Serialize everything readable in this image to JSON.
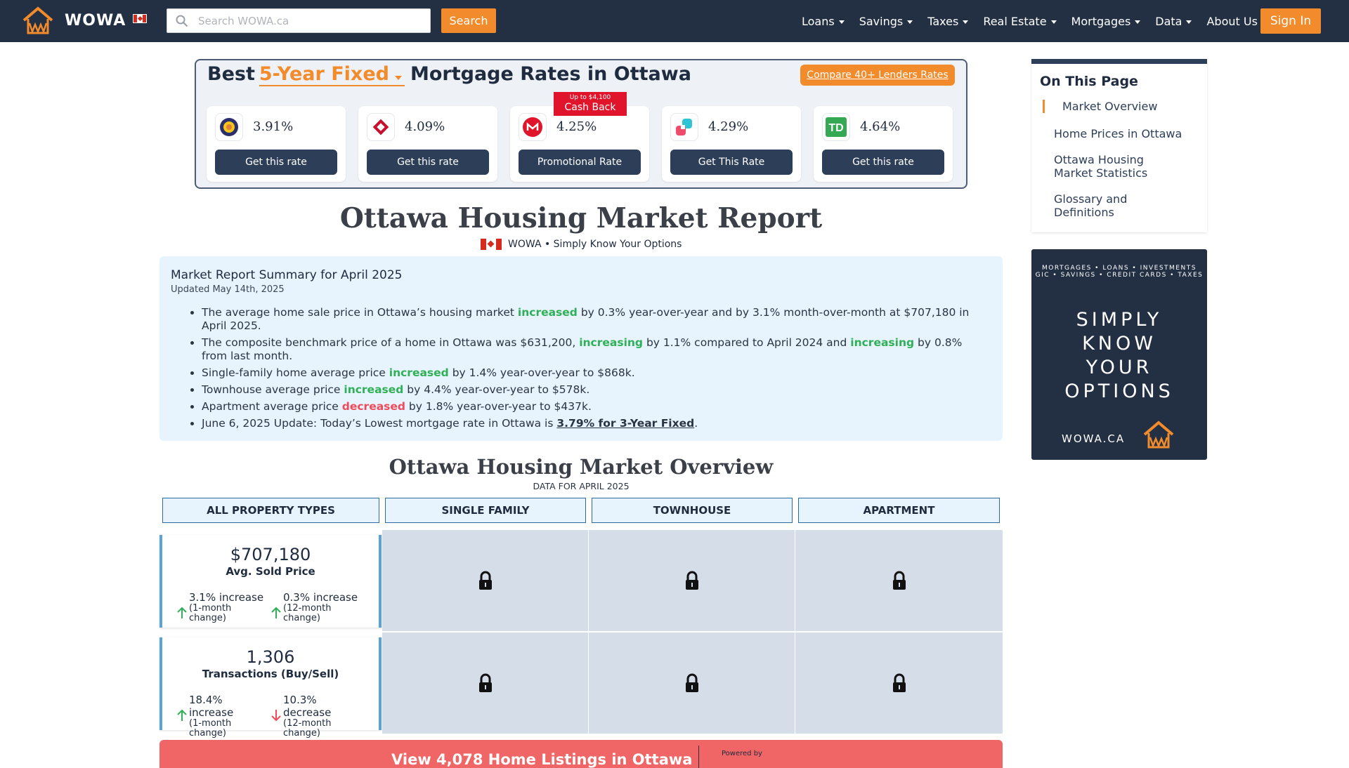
{
  "header": {
    "logo_text": "WOWA",
    "search_placeholder": "Search WOWA.ca",
    "search_button": "Search",
    "nav": [
      "Loans",
      "Savings",
      "Taxes",
      "Real Estate",
      "Mortgages",
      "Data",
      "About Us"
    ],
    "signin": "Sign In"
  },
  "rates": {
    "title_prefix": "Best",
    "product": "5-Year Fixed",
    "title_suffix": "Mortgage Rates in Ottawa",
    "compare_button": "Compare 40+ Lenders Rates",
    "cards": [
      {
        "rate": "3.91%",
        "button": "Get this rate",
        "logo": "circle-logo-icon"
      },
      {
        "rate": "4.09%",
        "button": "Get this rate",
        "logo": "diamond-logo-icon"
      },
      {
        "rate": "4.25%",
        "button": "Promotional Rate",
        "logo": "bmo-logo-icon",
        "badge_small": "Up to $4,100",
        "badge_big": "Cash Back"
      },
      {
        "rate": "4.29%",
        "button": "Get This Rate",
        "logo": "squares-logo-icon"
      },
      {
        "rate": "4.64%",
        "button": "Get this rate",
        "logo": "td-logo-icon"
      }
    ]
  },
  "report": {
    "title": "Ottawa Housing Market Report",
    "byline": "WOWA • Simply Know Your Options"
  },
  "summary": {
    "heading": "Market Report Summary for April 2025",
    "updated": "Updated May 14th, 2025",
    "b1": {
      "pre": "The average home sale price in Ottawa’s housing market ",
      "kw": "increased",
      "post": " by 0.3% year-over-year and by 3.1% month-over-month at $707,180 in April 2025."
    },
    "b2": {
      "pre": "The composite benchmark price of a home in Ottawa was $631,200, ",
      "kw": "increasing",
      "mid": " by 1.1% compared to April 2024 and ",
      "kw2": "increasing",
      "post": " by 0.8% from last month."
    },
    "b3": {
      "pre": "Single-family home average price ",
      "kw": "increased",
      "post": " by 1.4% year-over-year to $868k."
    },
    "b4": {
      "pre": "Townhouse average price ",
      "kw": "increased",
      "post": " by 4.4% year-over-year to $578k."
    },
    "b5": {
      "pre": "Apartment average price ",
      "kw": "decreased",
      "post": " by 1.8% year-over-year to $437k."
    },
    "b6": {
      "pre": "June 6, 2025 Update: Today’s Lowest mortgage rate in Ottawa is ",
      "link": "3.79% for 3-Year Fixed",
      "post": "."
    }
  },
  "overview": {
    "title": "Ottawa Housing Market Overview",
    "subtitle": "DATA FOR APRIL 2025",
    "columns": [
      "ALL PROPERTY TYPES",
      "SINGLE FAMILY",
      "TOWNHOUSE",
      "APARTMENT"
    ],
    "price": {
      "value": "$707,180",
      "label": "Avg. Sold Price",
      "m_val": "3.1% increase",
      "m_lbl": "(1-month change)",
      "y_val": "0.3% increase",
      "y_lbl": "(12-month change)"
    },
    "transactions": {
      "value": "1,306",
      "label": "Transactions (Buy/Sell)",
      "m_val": "18.4% increase",
      "m_lbl": "(1-month change)",
      "y_val": "10.3% decrease",
      "y_lbl": "(12-month change)"
    }
  },
  "listings": {
    "text": "View 4,078 Home Listings in Ottawa",
    "powered": "Powered by"
  },
  "toc": {
    "title": "On This Page",
    "items": [
      "Market Overview",
      "Home Prices in Ottawa",
      "Ottawa Housing Market Statistics",
      "Glossary and Definitions"
    ]
  },
  "ad": {
    "tag1": "MORTGAGES • LOANS • INVESTMENTS",
    "tag2": "GIC • SAVINGS • CREDIT CARDS • TAXES",
    "line1": "SIMPLY",
    "line2": "KNOW",
    "line3": "YOUR",
    "line4": "OPTIONS",
    "brand": "WOWA.CA"
  },
  "colors": {
    "navy": "#233044",
    "orange": "#f18b2b",
    "green": "#2fb057",
    "red": "#ef4b5a",
    "light_blue": "#e8f4fd"
  }
}
